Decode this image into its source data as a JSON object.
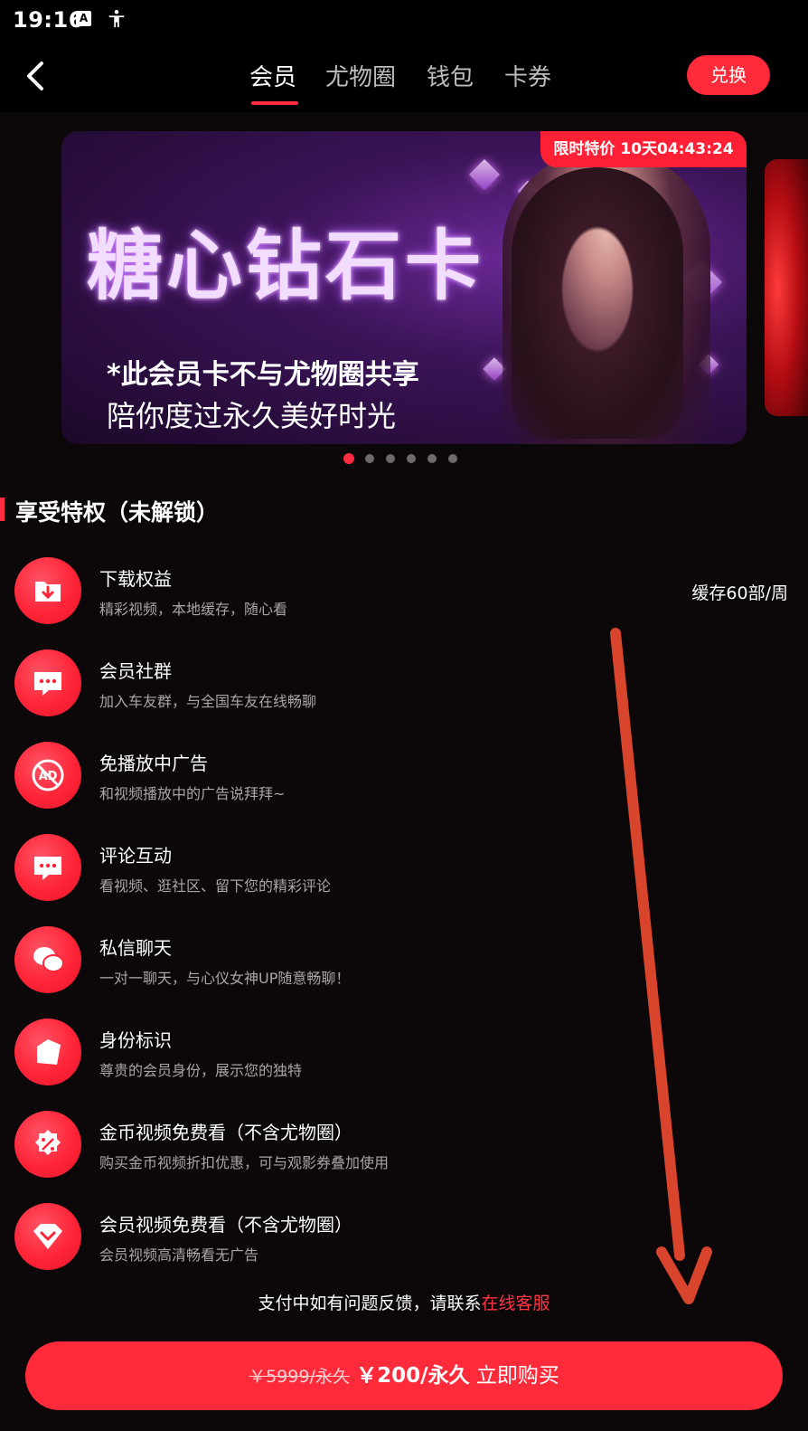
{
  "status_bar": {
    "time": "19:16",
    "icon_a_letter": "A"
  },
  "header": {
    "tabs": [
      {
        "label": "会员"
      },
      {
        "label": "尤物圈"
      },
      {
        "label": "钱包"
      },
      {
        "label": "卡券"
      }
    ],
    "active_tab": "会员",
    "exchange_label": "兑换"
  },
  "banner": {
    "badge": "限时特价 10天04:43:24",
    "title": "糖心钻石卡",
    "subtitle1": "*此会员卡不与尤物圈共享",
    "subtitle2": "陪你度过永久美好时光",
    "page_count": 6,
    "current_page": 1
  },
  "section": {
    "title": "享受特权（未解锁）"
  },
  "privileges": [
    {
      "icon": "download-folder-icon",
      "title": "下载权益",
      "desc": "精彩视频，本地缓存，随心看",
      "extra": "缓存60部/周"
    },
    {
      "icon": "chat-bubble-icon",
      "title": "会员社群",
      "desc": "加入车友群，与全国车友在线畅聊"
    },
    {
      "icon": "no-ad-icon",
      "title": "免播放中广告",
      "desc": "和视频播放中的广告说拜拜~"
    },
    {
      "icon": "comment-icon",
      "title": "评论互动",
      "desc": "看视频、逛社区、留下您的精彩评论"
    },
    {
      "icon": "private-message-icon",
      "title": "私信聊天",
      "desc": "一对一聊天，与心仪女神UP随意畅聊！"
    },
    {
      "icon": "identity-tag-icon",
      "title": "身份标识",
      "desc": "尊贵的会员身份，展示您的独特"
    },
    {
      "icon": "discount-icon",
      "title": "金币视频免费看（不含尤物圈）",
      "desc": "购买金币视频折扣优惠，可与观影券叠加使用"
    },
    {
      "icon": "diamond-icon",
      "title": "会员视频免费看（不含尤物圈）",
      "desc": "会员视频高清畅看无广告"
    }
  ],
  "support": {
    "text": "支付中如有问题反馈，请联系",
    "link": "在线客服"
  },
  "purchase": {
    "old_price": "￥5999/永久",
    "new_price": "￥200/永久",
    "action": "立即购买"
  },
  "colors": {
    "accent": "#ff2b3b",
    "background": "#0c0709"
  }
}
